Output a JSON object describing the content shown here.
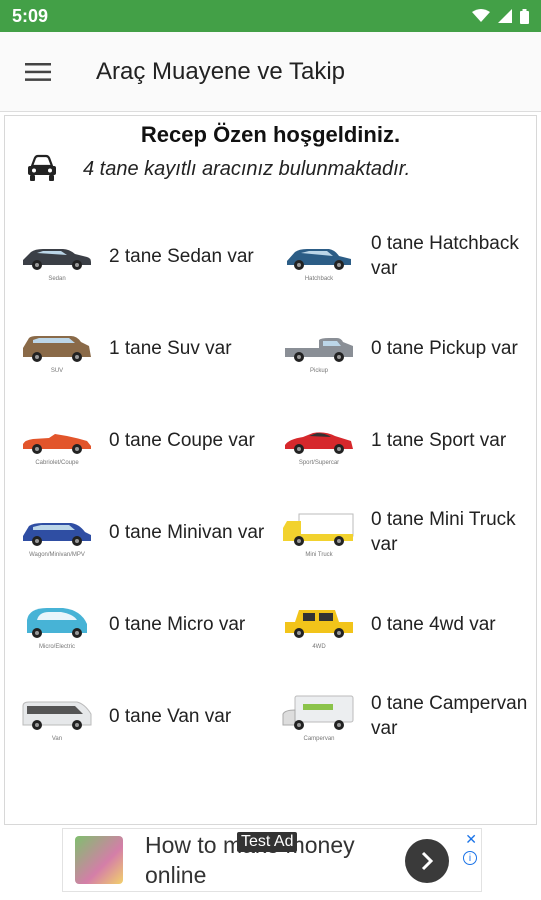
{
  "status_bar": {
    "time": "5:09",
    "icons": [
      "wifi-icon",
      "signal-icon",
      "battery-icon"
    ]
  },
  "app_bar": {
    "title": "Araç Muayene ve Takip",
    "menu_icon": "hamburger-menu-icon"
  },
  "welcome": "Recep Özen hoşgeldiniz.",
  "vehicle_count_text": "4 tane kayıtlı aracınız bulunmaktadır.",
  "vehicle_types": [
    {
      "caption": "Sedan",
      "label": "2 tane Sedan var",
      "color": "#3b3f46",
      "shape": "sedan"
    },
    {
      "caption": "Hatchback",
      "label": "0 tane Hatchback var",
      "color": "#2c5d86",
      "shape": "hatch"
    },
    {
      "caption": "SUV",
      "label": "1 tane Suv var",
      "color": "#8a6a48",
      "shape": "suv"
    },
    {
      "caption": "Pickup",
      "label": "0 tane Pickup var",
      "color": "#8a8f96",
      "shape": "pickup"
    },
    {
      "caption": "Cabriolet/Coupe",
      "label": "0 tane Coupe var",
      "color": "#e2552b",
      "shape": "coupe"
    },
    {
      "caption": "Sport/Supercar",
      "label": "1 tane Sport var",
      "color": "#d6282c",
      "shape": "sport"
    },
    {
      "caption": "Wagon/Minivan/MPV",
      "label": "0 tane Minivan var",
      "color": "#2f4ea3",
      "shape": "minivan"
    },
    {
      "caption": "Mini Truck",
      "label": "0 tane Mini Truck var",
      "color": "#f2d22e",
      "shape": "truck"
    },
    {
      "caption": "Micro/Electric",
      "label": "0 tane Micro var",
      "color": "#47b3d6",
      "shape": "micro"
    },
    {
      "caption": "4WD",
      "label": "0 tane 4wd var",
      "color": "#f2c41a",
      "shape": "jeep"
    },
    {
      "caption": "Van",
      "label": "0 tane Van var",
      "color": "#e6e8ea",
      "shape": "van"
    },
    {
      "caption": "Campervan",
      "label": "0 tane Campervan var",
      "color": "#eceef0",
      "shape": "camper"
    }
  ],
  "ad": {
    "text": "How to make money online",
    "tag": "Test Ad",
    "close": "✕",
    "info": "i"
  }
}
